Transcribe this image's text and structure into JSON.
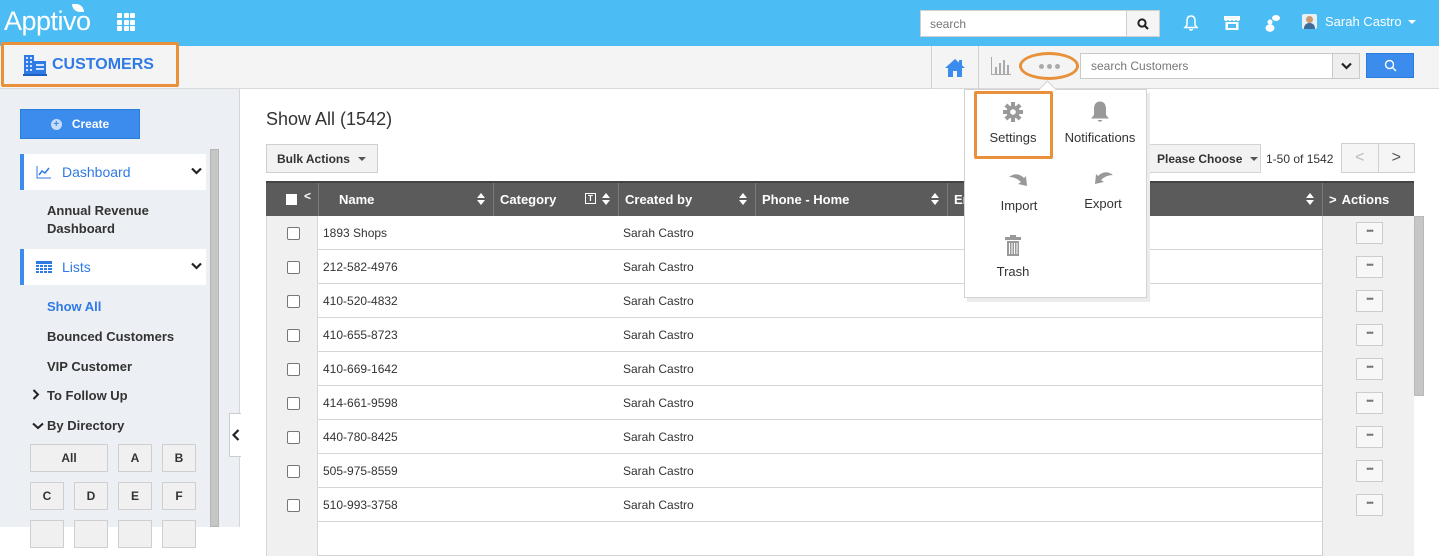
{
  "app": {
    "logo": "Apptivo",
    "module_title": "CUSTOMERS",
    "accent_color": "#2f7ae5",
    "topbar_color": "#4bbdf4",
    "highlight_color": "#e8913a"
  },
  "topbar": {
    "search_placeholder": "search",
    "user_name": "Sarah Castro",
    "icons": [
      "apps-grid-icon",
      "search-icon",
      "bell-icon",
      "store-icon",
      "chat-user-icon",
      "avatar-icon"
    ]
  },
  "subbar": {
    "module_search_placeholder": "search Customers",
    "icons": [
      "home-icon",
      "bar-chart-icon",
      "more-dots-icon",
      "chevron-down-icon",
      "search-icon"
    ]
  },
  "sidebar": {
    "create_label": "Create",
    "dashboard": {
      "label": "Dashboard",
      "items": [
        "Annual Revenue Dashboard"
      ]
    },
    "lists": {
      "label": "Lists",
      "items": [
        {
          "label": "Show All",
          "active": true
        },
        {
          "label": "Bounced Customers",
          "active": false
        },
        {
          "label": "VIP Customer",
          "active": false
        }
      ]
    },
    "trees": [
      {
        "label": "To Follow Up",
        "expanded": false
      },
      {
        "label": "By Directory",
        "expanded": true
      }
    ],
    "directory": [
      "All",
      "A",
      "B",
      "C",
      "D",
      "E",
      "F"
    ]
  },
  "main": {
    "title": "Show All (1542)",
    "bulk_actions_label": "Bulk Actions",
    "view_select": "Please Choose",
    "range_text": "1-50 of 1542",
    "pager_prev": "<",
    "pager_next": ">",
    "columns": [
      "Name",
      "Category",
      "Created by",
      "Phone - Home",
      "Em",
      "Actions"
    ],
    "rows": [
      {
        "name": "1893 Shops",
        "created_by": "Sarah Castro"
      },
      {
        "name": "212-582-4976",
        "created_by": "Sarah Castro"
      },
      {
        "name": "410-520-4832",
        "created_by": "Sarah Castro"
      },
      {
        "name": "410-655-8723",
        "created_by": "Sarah Castro"
      },
      {
        "name": "410-669-1642",
        "created_by": "Sarah Castro"
      },
      {
        "name": "414-661-9598",
        "created_by": "Sarah Castro"
      },
      {
        "name": "440-780-8425",
        "created_by": "Sarah Castro"
      },
      {
        "name": "505-975-8559",
        "created_by": "Sarah Castro"
      },
      {
        "name": "510-993-3758",
        "created_by": "Sarah Castro"
      }
    ],
    "row_action_label": "•••"
  },
  "more_menu": {
    "items": [
      {
        "label": "Settings",
        "icon": "gear-icon",
        "highlighted": true
      },
      {
        "label": "Notifications",
        "icon": "bell-icon",
        "highlighted": false
      },
      {
        "label": "Import",
        "icon": "import-arrow-icon",
        "highlighted": false
      },
      {
        "label": "Export",
        "icon": "export-arrow-icon",
        "highlighted": false
      },
      {
        "label": "Trash",
        "icon": "trash-icon",
        "highlighted": false
      }
    ]
  }
}
